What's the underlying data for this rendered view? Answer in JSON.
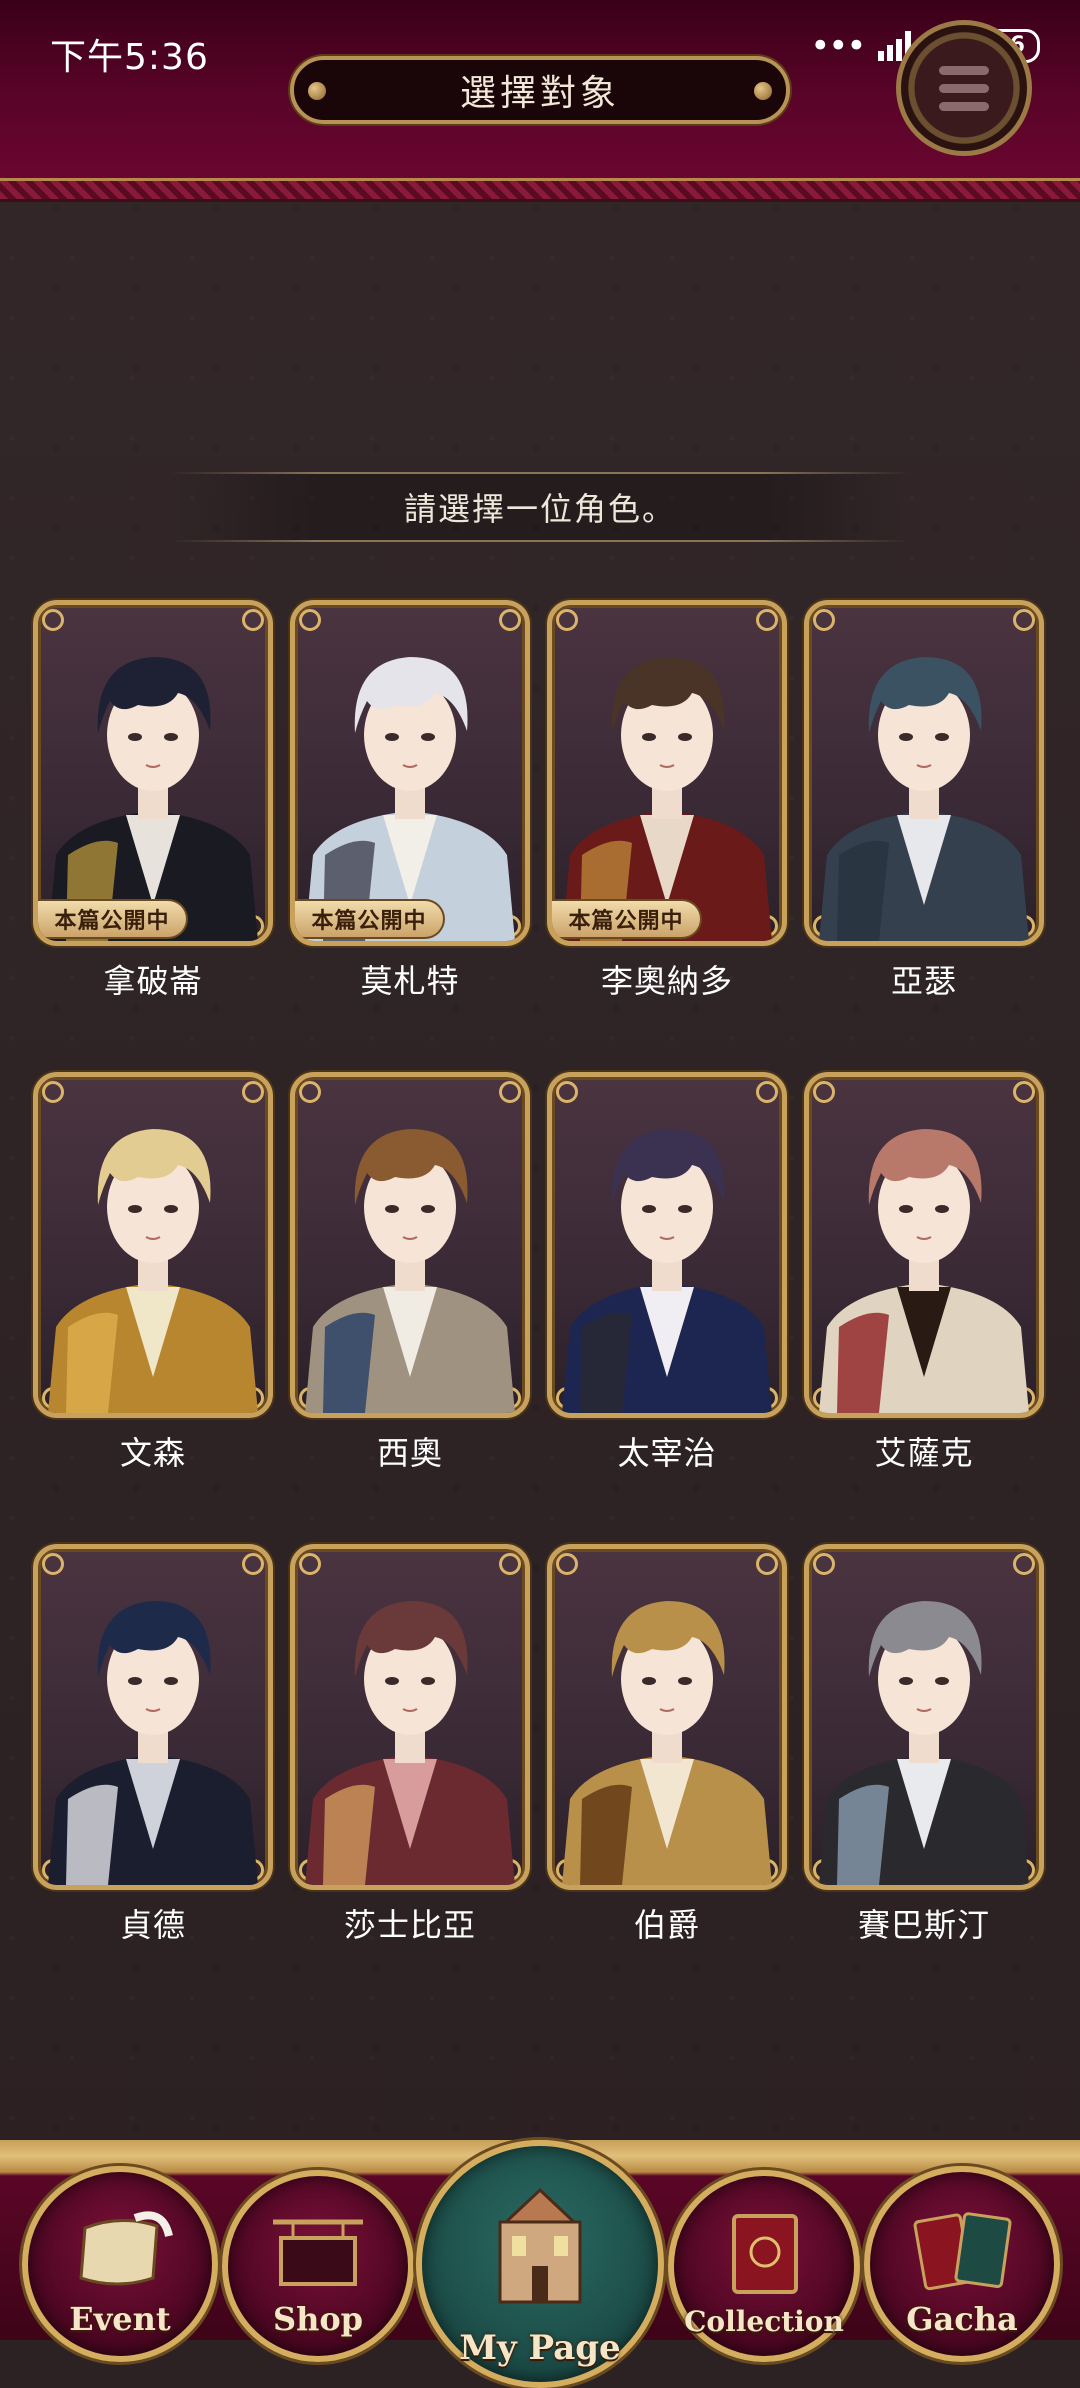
{
  "status_bar": {
    "time": "下午5:36",
    "dots": "•••",
    "battery": "46"
  },
  "header": {
    "title": "選擇對象"
  },
  "prompt": "請選擇一位角色。",
  "badge_text": "本篇公開中",
  "characters": [
    {
      "name": "拿破崙",
      "badge": true,
      "hair": "#1e2133",
      "coat": "#1a1a22",
      "accent": "#b8963c",
      "shirt": "#e8e2dc"
    },
    {
      "name": "莫札特",
      "badge": true,
      "hair": "#e4e4ea",
      "coat": "#c4d0dc",
      "accent": "#3a3a48",
      "shirt": "#f2eee8"
    },
    {
      "name": "李奧納多",
      "badge": true,
      "hair": "#4a3428",
      "coat": "#6a1a18",
      "accent": "#c08a3a",
      "shirt": "#e8d8c8"
    },
    {
      "name": "亞瑟",
      "badge": false,
      "hair": "#3a5262",
      "coat": "#34404e",
      "accent": "#26313d",
      "shirt": "#e6e8ec"
    },
    {
      "name": "文森",
      "badge": false,
      "hair": "#e2cc92",
      "coat": "#b8862e",
      "accent": "#e0b050",
      "shirt": "#f0e6c8"
    },
    {
      "name": "西奧",
      "badge": false,
      "hair": "#8a5a30",
      "coat": "#a09280",
      "accent": "#1e3a66",
      "shirt": "#f0ece4"
    },
    {
      "name": "太宰治",
      "badge": false,
      "hair": "#3a3250",
      "coat": "#1c2650",
      "accent": "#2a2a30",
      "shirt": "#f0eef2"
    },
    {
      "name": "艾薩克",
      "badge": false,
      "hair": "#b8786a",
      "coat": "#e0d4c0",
      "accent": "#8a1418",
      "shirt": "#2a1a14"
    },
    {
      "name": "貞德",
      "badge": false,
      "hair": "#1e2a4a",
      "coat": "#1a1e2e",
      "accent": "#f0f0f4",
      "shirt": "#cfd2da"
    },
    {
      "name": "莎士比亞",
      "badge": false,
      "hair": "#6a3a3a",
      "coat": "#6a2a30",
      "accent": "#d8a060",
      "shirt": "#d89c9c"
    },
    {
      "name": "伯爵",
      "badge": false,
      "hair": "#b8904a",
      "coat": "#b8904a",
      "accent": "#5a3010",
      "shirt": "#f2e6d0"
    },
    {
      "name": "賽巴斯汀",
      "badge": false,
      "hair": "#8a8a90",
      "coat": "#2a2a2e",
      "accent": "#90a4b8",
      "shirt": "#e8eaee"
    }
  ],
  "nav": {
    "event": "Event",
    "shop": "Shop",
    "mypage": "My Page",
    "collection": "Collection",
    "gacha": "Gacha"
  },
  "colors": {
    "header": "#5a0428",
    "gold": "#c8a25c",
    "background": "#2e2325",
    "nav_main": "#1b4a46"
  }
}
